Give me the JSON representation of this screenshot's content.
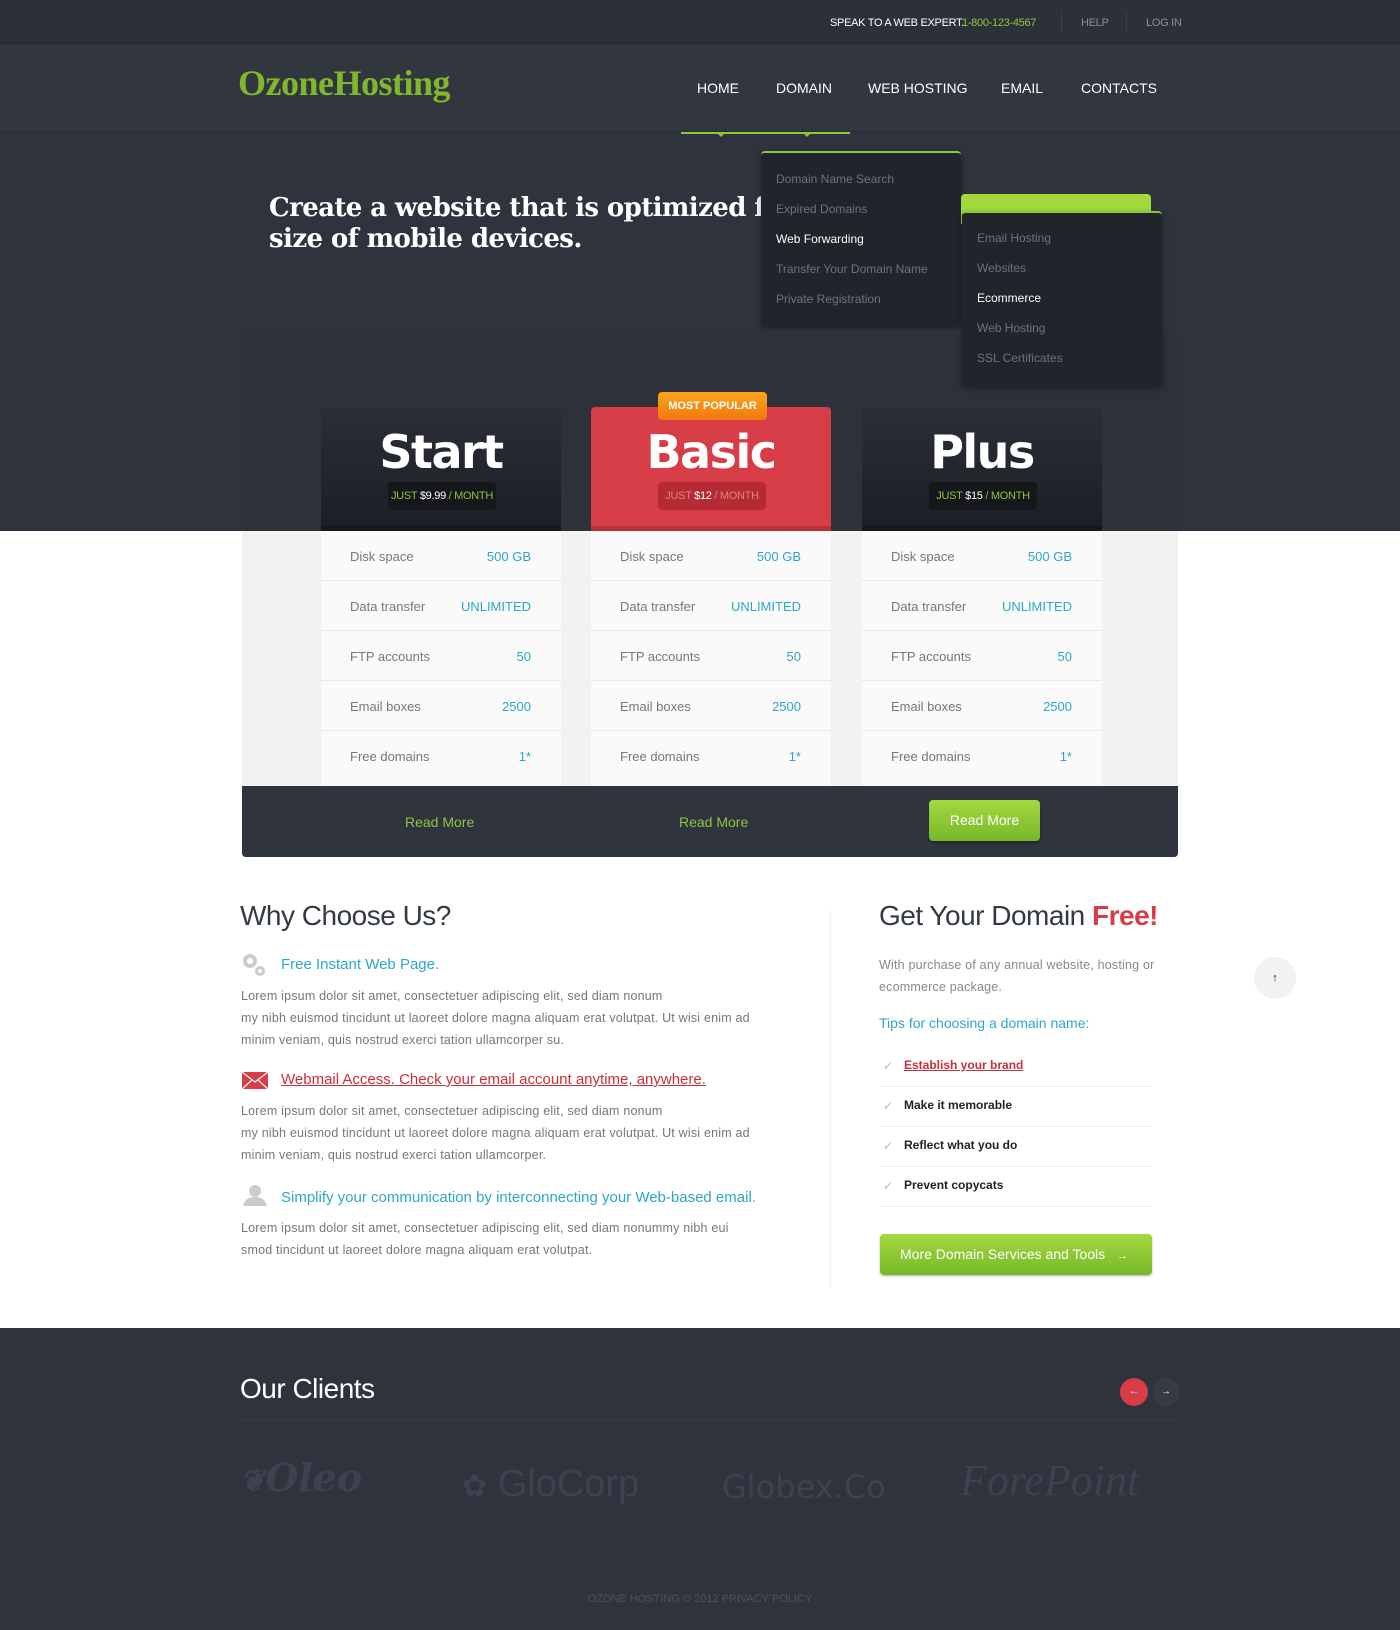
{
  "topbar": {
    "speak": "SPEAK TO A WEB EXPERT.",
    "phone": "1-800-123-4567",
    "help": "HELP",
    "login": "LOG IN"
  },
  "logo": "OzoneHosting",
  "nav": [
    "HOME",
    "DOMAIN",
    "WEB HOSTING",
    "EMAIL",
    "CONTACTS"
  ],
  "hero": "Create a website that is optimized for the size of mobile devices.",
  "hero_line1": "Create a website that is optimized for th",
  "hero_line2": "size of mobile devices.",
  "domain_menu": [
    "Domain Name Search",
    "Expired Domains",
    "Web Forwarding",
    "Transfer Your Domain Name",
    "Private Registration"
  ],
  "hosting_menu": [
    "Email Hosting",
    "Websites",
    "Ecommerce",
    "Web Hosting",
    "SSL Certificates"
  ],
  "most_popular": "MOST POPULAR",
  "plans": [
    {
      "name": "Start",
      "just": "JUST",
      "price": "$9.99",
      "per": "/ MONTH",
      "read_more": "Read More"
    },
    {
      "name": "Basic",
      "just": "JUST",
      "price": "$12",
      "per": "/ MONTH",
      "read_more": "Read More"
    },
    {
      "name": "Plus",
      "just": "JUST",
      "price": "$15",
      "per": "/ MONTH",
      "read_more": "Read More"
    }
  ],
  "features": [
    {
      "label": "Disk space",
      "value": "500 GB"
    },
    {
      "label": "Data transfer",
      "value": "UNLIMITED"
    },
    {
      "label": "FTP accounts",
      "value": "50"
    },
    {
      "label": "Email boxes",
      "value": "2500"
    },
    {
      "label": "Free domains",
      "value": "1*"
    }
  ],
  "why": {
    "title": "Why Choose Us?",
    "items": [
      {
        "heading": "Free Instant Web Page.",
        "lines": [
          "Lorem ipsum dolor sit amet, consectetuer adipiscing elit, sed diam nonum",
          "my nibh euismod tincidunt ut laoreet dolore magna aliquam erat volutpat. Ut wisi enim ad",
          "minim veniam, quis nostrud exerci tation ullamcorper su."
        ]
      },
      {
        "heading": "Webmail Access. Check your email account anytime, anywhere.",
        "lines": [
          "Lorem ipsum dolor sit amet, consectetuer adipiscing elit, sed diam nonum",
          "my nibh euismod tincidunt ut laoreet dolore magna aliquam erat volutpat. Ut wisi enim ad",
          "minim veniam, quis nostrud exerci tation ullamcorper."
        ]
      },
      {
        "heading": "Simplify your communication by interconnecting your Web-based email.",
        "lines": [
          "Lorem ipsum dolor sit amet, consectetuer adipiscing elit, sed diam nonummy nibh eui",
          "smod tincidunt ut laoreet dolore magna aliquam erat volutpat."
        ]
      }
    ]
  },
  "domain": {
    "title": "Get Your Domain",
    "title_accent": "Free!",
    "desc": [
      "With purchase of any annual website, hosting or",
      "ecommerce package."
    ],
    "tips_title": "Tips for choosing a domain name:",
    "tips": [
      "Establish your brand",
      "Make it memorable",
      "Reflect what you do",
      "Prevent copycats"
    ],
    "button": "More Domain Services and Tools",
    "button_arrow": "→"
  },
  "scroll_top": "↑",
  "clients": {
    "title": "Our Clients",
    "prev": "←",
    "next": "→",
    "logos": [
      "Oleo",
      "GloCorp",
      "Globex.Co",
      "ForePoint"
    ]
  },
  "footer": "OZONE HOSTING © 2012 PRIVACY POLICY",
  "colors": {
    "accent_green": "#8cc63e",
    "accent_red": "#d63d47",
    "link_blue": "#2ea6c7",
    "dark_bg": "#2e333d"
  }
}
